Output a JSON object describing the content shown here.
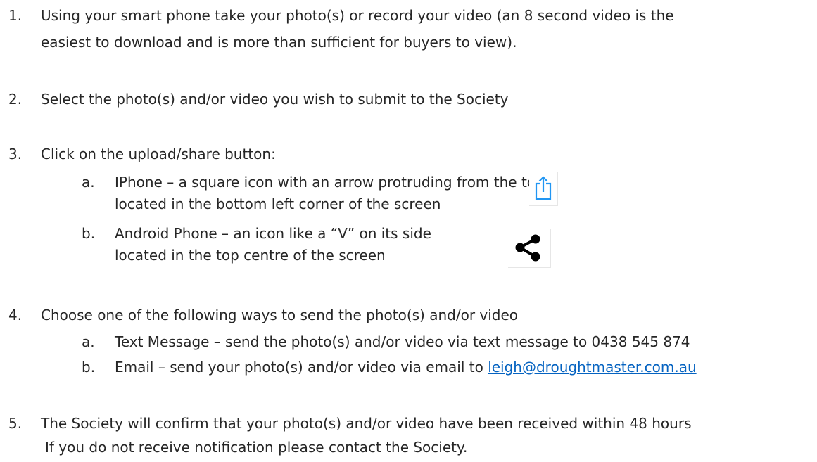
{
  "steps": [
    {
      "number": "1.",
      "lines": [
        "Using your smart phone take your photo(s) or record your video (an 8 second video is the",
        "easiest to download and is more than sufficient for buyers to view)."
      ]
    },
    {
      "number": "2.",
      "lines": [
        "Select the photo(s) and/or video you wish to submit to the Society"
      ]
    },
    {
      "number": "3.",
      "lines": [
        "Click on the upload/share button:"
      ],
      "subitems": [
        {
          "letter": "a.",
          "lines": [
            "IPhone – a square icon with an arrow protruding from the top,",
            "located in the bottom left corner of the screen"
          ],
          "icon": "ios-share-icon"
        },
        {
          "letter": "b.",
          "lines": [
            "Android Phone – an icon like a “V” on its side",
            "located in the top centre of the screen"
          ],
          "icon": "android-share-icon"
        }
      ]
    },
    {
      "number": "4.",
      "lines": [
        "Choose one of the following ways to send the photo(s) and/or video"
      ],
      "subitems": [
        {
          "letter": "a.",
          "lines": [
            "Text Message – send the photo(s) and/or video via text message to 0438 545 874"
          ]
        },
        {
          "letter": "b.",
          "text": "Email – send your photo(s) and/or video via email to ",
          "link": "leigh@droughtmaster.com.au"
        }
      ]
    },
    {
      "number": "5.",
      "lines": [
        "The Society will confirm that your photo(s) and/or video have been received within 48 hours",
        "If you do not receive notification please contact the Society."
      ]
    }
  ],
  "colors": {
    "text": "#262626",
    "link": "#0563c1",
    "ios_icon": "#2196f3",
    "android_icon": "#000000"
  }
}
